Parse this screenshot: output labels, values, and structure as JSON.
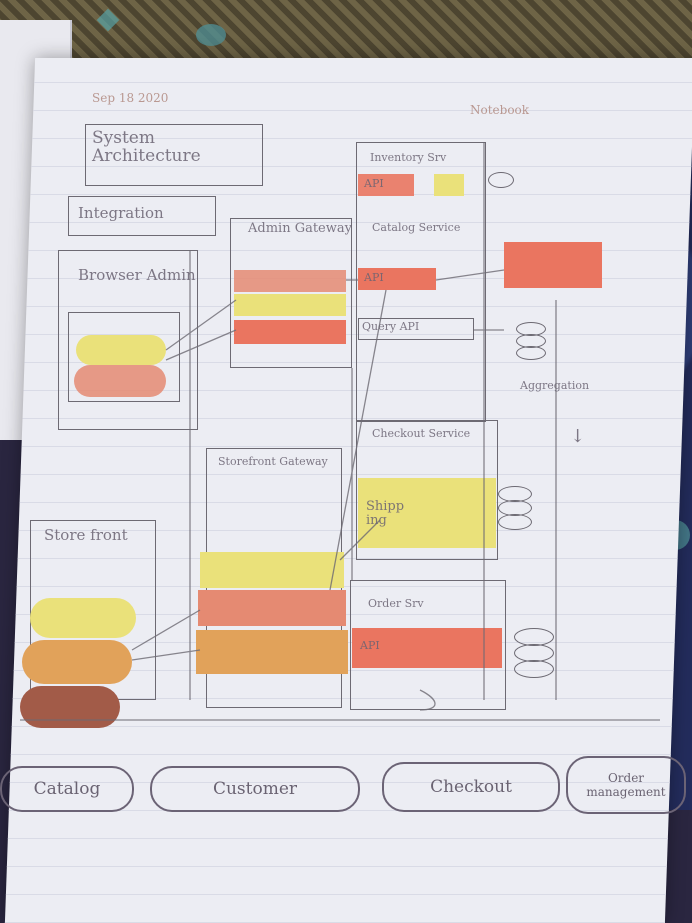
{
  "header": {
    "date_text": "Sep 18 2020",
    "right_text": "Notebook"
  },
  "diagram": {
    "title": "System Architecture",
    "integration_label": "Integration",
    "browser_admin_label": "Browser Admin",
    "admin_gateway_label": "Admin Gateway",
    "inventory_label": "Inventory Srv",
    "api_label_1": "API",
    "catalog_service_label": "Catalog Service",
    "api_label_2": "API",
    "query_api_label": "Query API",
    "aggregation_label": "Aggregation",
    "checkout_service_label": "Checkout Service",
    "storefront_gateway_label": "Storefront Gateway",
    "shipping_label": "Shipp ing",
    "storefront_label": "Store front",
    "order_service_label": "Order Srv",
    "api_label_3": "API"
  },
  "legend": {
    "items": [
      {
        "label": "Catalog"
      },
      {
        "label": "Customer"
      },
      {
        "label": "Checkout"
      },
      {
        "label": "Order management"
      }
    ]
  },
  "colors": {
    "yellow": "#eae17a",
    "salmon": "#e58a72",
    "brick": "#a25b48",
    "orange": "#e1a25a",
    "red": "#ea7560"
  }
}
